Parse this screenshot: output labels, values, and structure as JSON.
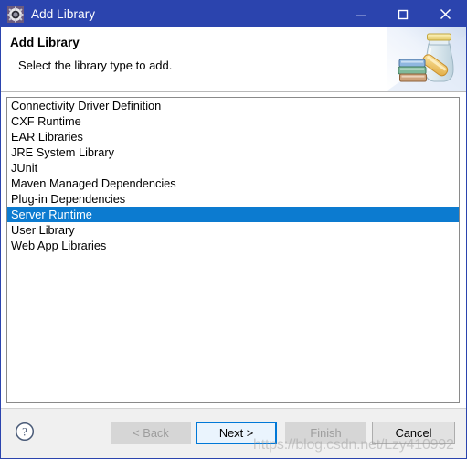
{
  "window": {
    "title": "Add Library",
    "icon": "gear-icon",
    "accent_color": "#2b44ae",
    "controls": {
      "minimize": "—",
      "maximize": "□",
      "close": "✕"
    }
  },
  "banner": {
    "heading": "Add Library",
    "subtitle": "Select the library type to add.",
    "art": "jar-and-books-icon"
  },
  "list": {
    "selection_color": "#0c7bd0",
    "selected_index": 7,
    "items": [
      "Connectivity Driver Definition",
      "CXF Runtime",
      "EAR Libraries",
      "JRE System Library",
      "JUnit",
      "Maven Managed Dependencies",
      "Plug-in Dependencies",
      "Server Runtime",
      "User Library",
      "Web App Libraries"
    ]
  },
  "buttons": {
    "help": "?",
    "back": "< Back",
    "next": "Next >",
    "finish": "Finish",
    "cancel": "Cancel"
  },
  "watermark": {
    "text": "https://blog.csdn.net/Lzy410992"
  }
}
